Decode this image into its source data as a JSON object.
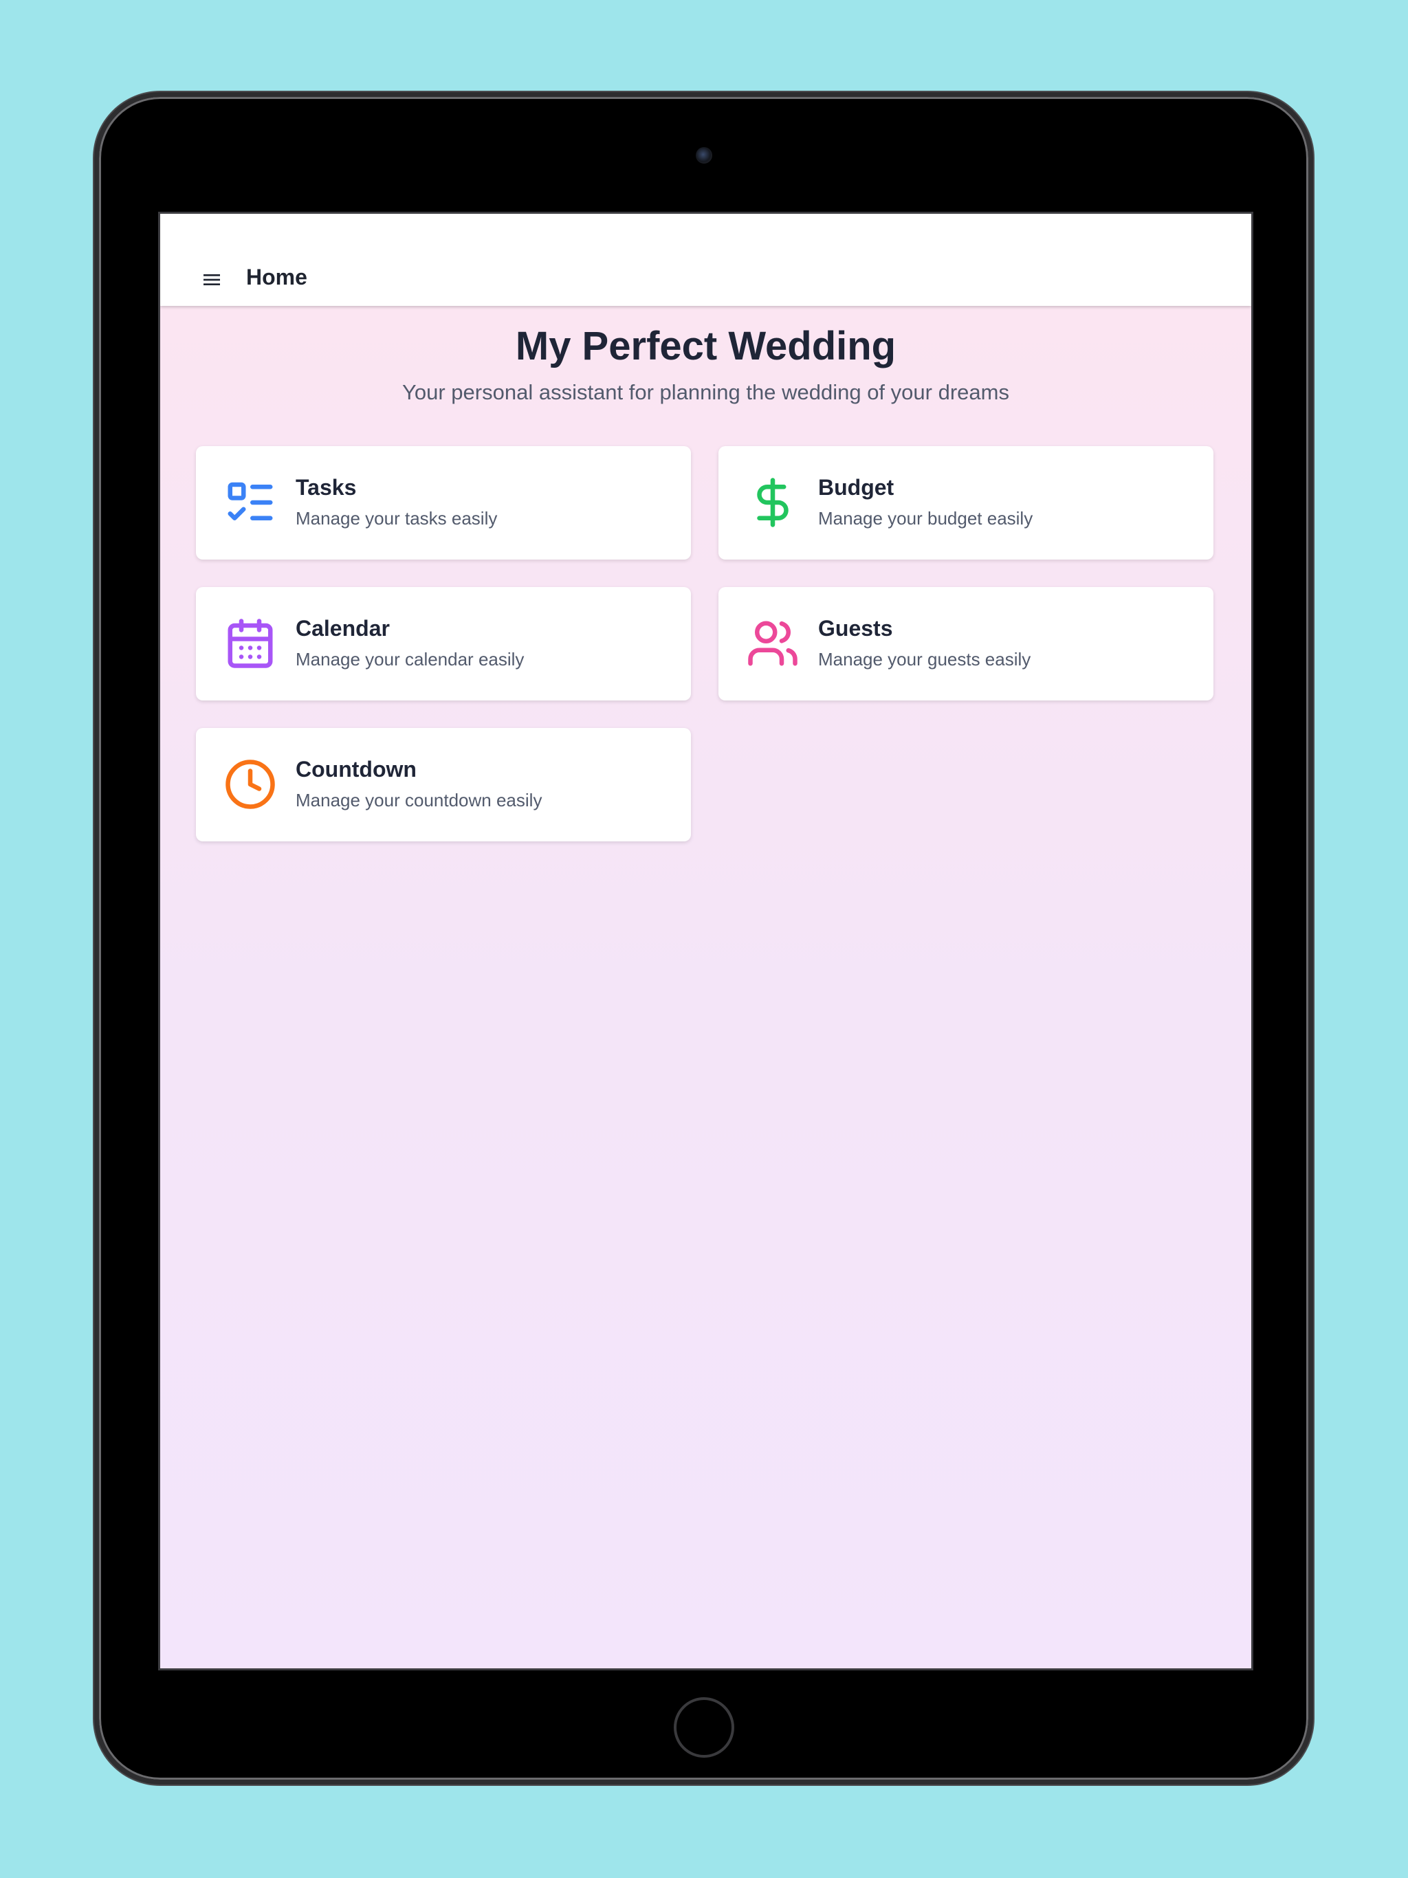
{
  "appbar": {
    "title": "Home",
    "menu_icon": "menu-icon"
  },
  "header": {
    "title": "My Perfect Wedding",
    "subtitle": "Your personal assistant for planning the wedding of your dreams"
  },
  "cards": [
    {
      "title": "Tasks",
      "description": "Manage your tasks easily",
      "icon": "checklist-icon",
      "color": "#3b82f6"
    },
    {
      "title": "Budget",
      "description": "Manage your budget easily",
      "icon": "dollar-icon",
      "color": "#22c55e"
    },
    {
      "title": "Calendar",
      "description": "Manage your calendar easily",
      "icon": "calendar-icon",
      "color": "#a855f7"
    },
    {
      "title": "Guests",
      "description": "Manage your guests easily",
      "icon": "users-icon",
      "color": "#ec4899"
    },
    {
      "title": "Countdown",
      "description": "Manage your countdown easily",
      "icon": "clock-icon",
      "color": "#f97316"
    }
  ],
  "theme": {
    "background_top": "#fce5f1",
    "background_bottom": "#f3e5fb",
    "text_primary": "#1f2537",
    "text_secondary": "#525a6c"
  }
}
